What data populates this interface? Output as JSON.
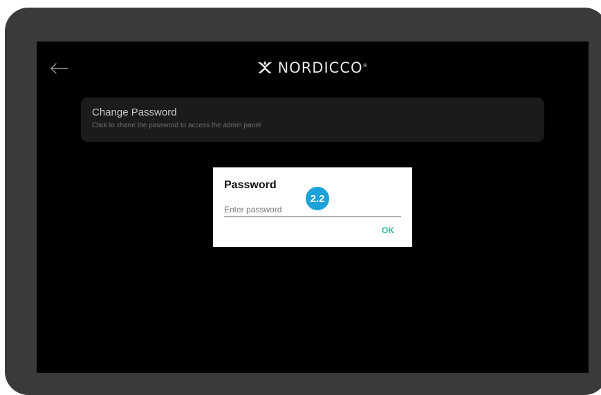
{
  "header": {
    "back_icon": "arrow-left-icon",
    "logo_icon": "nordicco-logo-icon",
    "logo_text": "NORDICCO",
    "logo_reg": "®"
  },
  "settings": {
    "change_password": {
      "title": "Change Password",
      "description": "Click to chane the password to access the admin panel"
    }
  },
  "dialog": {
    "title": "Password",
    "input_placeholder": "Enter password",
    "input_value": "",
    "ok_label": "OK",
    "step_badge": "2.2"
  },
  "colors": {
    "device_frame": "#3a3a3a",
    "screen_bg": "#000000",
    "card_bg": "#1b1b1b",
    "accent_ok": "#2fb5a0",
    "badge": "#1ba3d9"
  }
}
